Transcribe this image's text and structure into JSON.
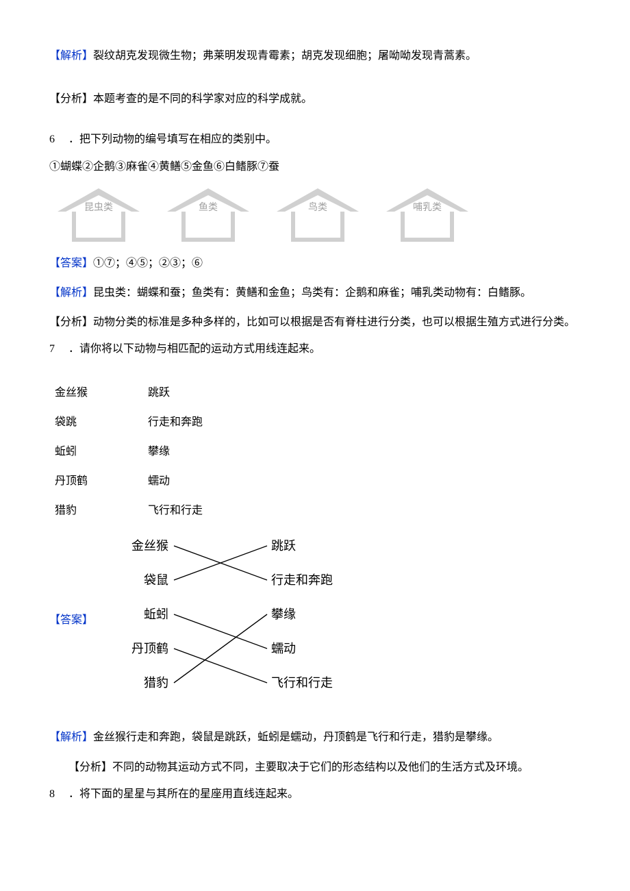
{
  "q5": {
    "jiexi_label": "【解析】",
    "jiexi_text": "裂纹胡克发现微生物；弗莱明发现青霉素；胡克发现细胞；屠呦呦发现青蒿素。",
    "fenxi_label": "【分析】",
    "fenxi_text": "本题考查的是不同的科学家对应的科学成就。"
  },
  "q6": {
    "number": "6",
    "dot": "．",
    "prompt": "把下列动物的编号填写在相应的类别中。",
    "items": "①蝴蝶②企鹅③麻雀④黄鳝⑤金鱼⑥白鳍豚⑦蚕",
    "arrows": [
      {
        "label": "昆虫类"
      },
      {
        "label": "鱼类"
      },
      {
        "label": "鸟类"
      },
      {
        "label": "哺乳类"
      }
    ],
    "daan_label": "【答案】",
    "daan_text": "①⑦；④⑤；②③；⑥",
    "jiexi_label": "【解析】",
    "jiexi_text": "昆虫类：蝴蝶和蚕；鱼类有：黄鳝和金鱼；鸟类有：企鹅和麻雀；哺乳类动物有：白鳍豚。",
    "fenxi_label": "【分析】",
    "fenxi_text": "动物分类的标准是多种多样的，比如可以根据是否有脊柱进行分类，也可以根据生殖方式进行分类。"
  },
  "q7": {
    "number": "7",
    "dot": "．",
    "prompt": "请你将以下动物与相匹配的运动方式用线连起来。",
    "pairs": [
      {
        "l": "金丝猴",
        "r": "跳跃"
      },
      {
        "l": "袋跳",
        "r": "行走和奔跑"
      },
      {
        "l": "蚯蚓",
        "r": "攀缘"
      },
      {
        "l": "丹顶鹤",
        "r": "蠕动"
      },
      {
        "l": "猎豹",
        "r": "飞行和行走"
      }
    ],
    "daan_label": "【答案】",
    "match": {
      "left": [
        "金丝猴",
        "袋鼠",
        "蚯蚓",
        "丹顶鹤",
        "猎豹"
      ],
      "right": [
        "跳跃",
        "行走和奔跑",
        "攀缘",
        "蠕动",
        "飞行和行走"
      ]
    },
    "jiexi_label": "【解析】",
    "jiexi_text": "金丝猴行走和奔跑，袋鼠是跳跃，蚯蚓是蠕动，丹顶鹤是飞行和行走，猎豹是攀缘。",
    "fenxi_label": "【分析】",
    "fenxi_text": "不同的动物其运动方式不同，主要取决于它们的形态结构以及他们的生活方式及环境。"
  },
  "q8": {
    "number": "8",
    "dot": "．",
    "prompt": "将下面的星星与其所在的星座用直线连起来。"
  }
}
